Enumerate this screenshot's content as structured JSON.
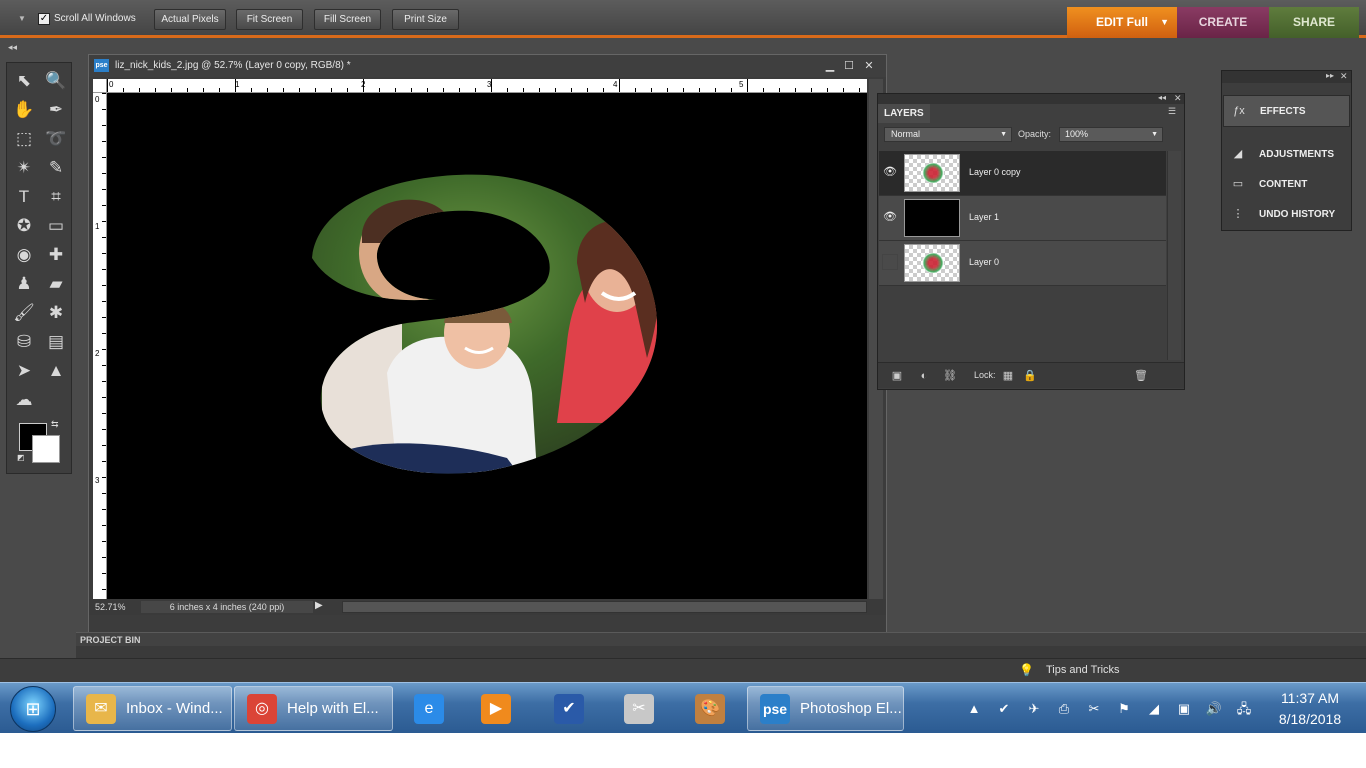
{
  "options_bar": {
    "scroll_all_label": "Scroll All Windows",
    "scroll_all_checked": true,
    "actual_pixels_label": "Actual Pixels",
    "fit_screen_label": "Fit Screen",
    "fill_screen_label": "Fill Screen",
    "print_size_label": "Print Size"
  },
  "mode_tabs": {
    "edit": "EDIT Full",
    "create": "CREATE",
    "share": "SHARE"
  },
  "colors": {
    "edit_tab": "#e07a17",
    "create_tab": "#7a2f55",
    "share_tab": "#527034",
    "accent_line": "#d86a1a",
    "foreground_swatch": "#000000",
    "background_swatch": "#ffffff"
  },
  "toolbox": {
    "tools": [
      {
        "name": "move-tool-icon",
        "glyph": "⬉"
      },
      {
        "name": "zoom-tool-icon",
        "glyph": "🔍"
      },
      {
        "name": "hand-tool-icon",
        "glyph": "✋"
      },
      {
        "name": "eyedropper-tool-icon",
        "glyph": "✒"
      },
      {
        "name": "marquee-tool-icon",
        "glyph": "⬚"
      },
      {
        "name": "lasso-tool-icon",
        "glyph": "➰"
      },
      {
        "name": "magic-wand-tool-icon",
        "glyph": "✴"
      },
      {
        "name": "selection-brush-tool-icon",
        "glyph": "✎"
      },
      {
        "name": "type-tool-icon",
        "glyph": "T"
      },
      {
        "name": "crop-tool-icon",
        "glyph": "⌗"
      },
      {
        "name": "cookie-cutter-tool-icon",
        "glyph": "✪"
      },
      {
        "name": "straighten-tool-icon",
        "glyph": "▭"
      },
      {
        "name": "red-eye-tool-icon",
        "glyph": "◉"
      },
      {
        "name": "healing-brush-tool-icon",
        "glyph": "✚"
      },
      {
        "name": "clone-stamp-tool-icon",
        "glyph": "♟"
      },
      {
        "name": "eraser-tool-icon",
        "glyph": "▰"
      },
      {
        "name": "brush-tool-icon",
        "glyph": "🖌"
      },
      {
        "name": "smart-brush-tool-icon",
        "glyph": "✱"
      },
      {
        "name": "paint-bucket-tool-icon",
        "glyph": "⛁"
      },
      {
        "name": "gradient-tool-icon",
        "glyph": "▤"
      },
      {
        "name": "custom-shape-tool-icon",
        "glyph": "➤"
      },
      {
        "name": "blur-tool-icon",
        "glyph": "▲"
      },
      {
        "name": "sponge-tool-icon",
        "glyph": "☁"
      }
    ]
  },
  "document": {
    "title": "liz_nick_kids_2.jpg @ 52.7% (Layer 0 copy, RGB/8) *",
    "app_badge": "pse",
    "ruler_h": [
      "0",
      "1",
      "2",
      "3",
      "4",
      "5"
    ],
    "ruler_v": [
      "0",
      "1",
      "2",
      "3"
    ],
    "zoom": "52.71%",
    "doc_size": "6 inches x 4 inches (240 ppi)"
  },
  "project_bin": {
    "label": "PROJECT BIN"
  },
  "tips": {
    "label": "Tips and Tricks"
  },
  "layers_panel": {
    "title": "LAYERS",
    "blend_mode": "Normal",
    "opacity_label": "Opacity:",
    "opacity_value": "100%",
    "lock_label": "Lock:",
    "layers": [
      {
        "name": "Layer 0 copy",
        "visible": true,
        "selected": true,
        "thumb": "photo"
      },
      {
        "name": "Layer 1",
        "visible": true,
        "selected": false,
        "thumb": "black"
      },
      {
        "name": "Layer 0",
        "visible": false,
        "selected": false,
        "thumb": "photo"
      }
    ]
  },
  "palette_bin": {
    "items": [
      {
        "label": "EFFECTS",
        "icon": "fx-icon"
      },
      {
        "label": "ADJUSTMENTS",
        "icon": "adjustments-icon"
      },
      {
        "label": "CONTENT",
        "icon": "content-icon"
      },
      {
        "label": "UNDO HISTORY",
        "icon": "undo-history-icon"
      }
    ]
  },
  "taskbar": {
    "buttons": [
      {
        "label": "Inbox - Wind...",
        "icon": "outlook-icon"
      },
      {
        "label": "Help with El...",
        "icon": "chrome-icon"
      },
      {
        "label": "",
        "icon": "internet-explorer-icon"
      },
      {
        "label": "",
        "icon": "media-player-icon"
      },
      {
        "label": "",
        "icon": "app-check-icon"
      },
      {
        "label": "",
        "icon": "snipping-tool-icon"
      },
      {
        "label": "",
        "icon": "paint-icon"
      },
      {
        "label": "Photoshop El...",
        "icon": "photoshop-elements-icon"
      }
    ],
    "pse_badge": "pse",
    "clock_time": "11:37 AM",
    "clock_date": "8/18/2018"
  }
}
